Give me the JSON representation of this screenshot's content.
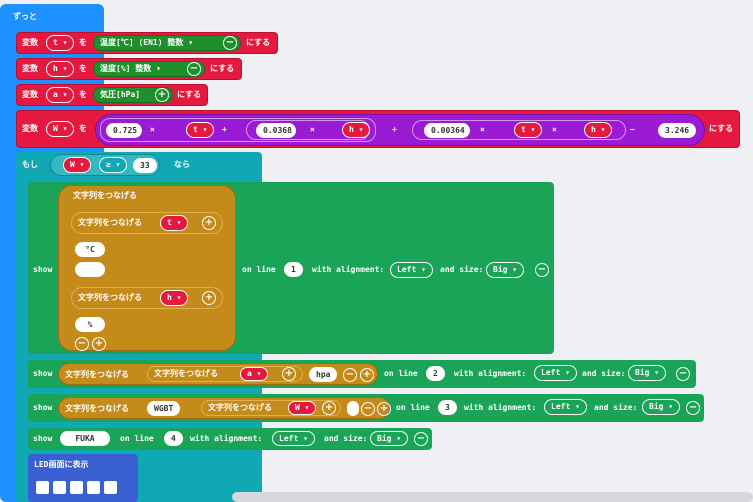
{
  "forever": {
    "label": "ずっと"
  },
  "keywords": {
    "var": "変数",
    "wo": "を",
    "nisuru": "にする",
    "times": "×",
    "plus": "+",
    "minus": "−",
    "moshi": "もし",
    "nara": "なら",
    "show": "show",
    "on_line": "on line",
    "with_alignment": "with alignment:",
    "and_size": "and size:",
    "join": "文字列をつなげる",
    "plus_icon": "+",
    "minus_icon": "−",
    "dropdown": "▾"
  },
  "assignments": [
    {
      "var": "t",
      "sensor": "温度[℃] (EN1) 整数"
    },
    {
      "var": "h",
      "sensor": "湿度[%] 整数"
    },
    {
      "var": "a",
      "sensor": "気圧[hPa]"
    }
  ],
  "wbgt": {
    "var": "W",
    "c1": "0.725",
    "v1": "t",
    "c2": "0.0368",
    "v2": "h",
    "c3": "0.00364",
    "v3a": "t",
    "v3b": "h",
    "c4": "3.246"
  },
  "condition": {
    "var": "W",
    "op": "≥",
    "value": "33"
  },
  "show1": {
    "t_var": "t",
    "deg": "°C",
    "space": " ",
    "h_var": "h",
    "pct": "%",
    "line": "1",
    "align": "Left",
    "size": "Big"
  },
  "show2": {
    "a_var": "a",
    "hpa": "hpa",
    "line": "2",
    "align": "Left",
    "size": "Big"
  },
  "show3": {
    "wbgt_text": "WGBT",
    "w_var": "W",
    "line": "3",
    "align": "Left",
    "size": "Big"
  },
  "show4": {
    "text": "FUKA",
    "line": "4",
    "align": "Left",
    "size": "Big"
  },
  "led": {
    "label": "LED画面に表示"
  },
  "colors": {
    "forever": "#1e90ff",
    "variable": "#e5193f",
    "if": "#0fa8b4",
    "show": "#1aa457",
    "text": "#c48a1a",
    "math": "#9b1ad4",
    "sensor": "#1f8f2c"
  }
}
